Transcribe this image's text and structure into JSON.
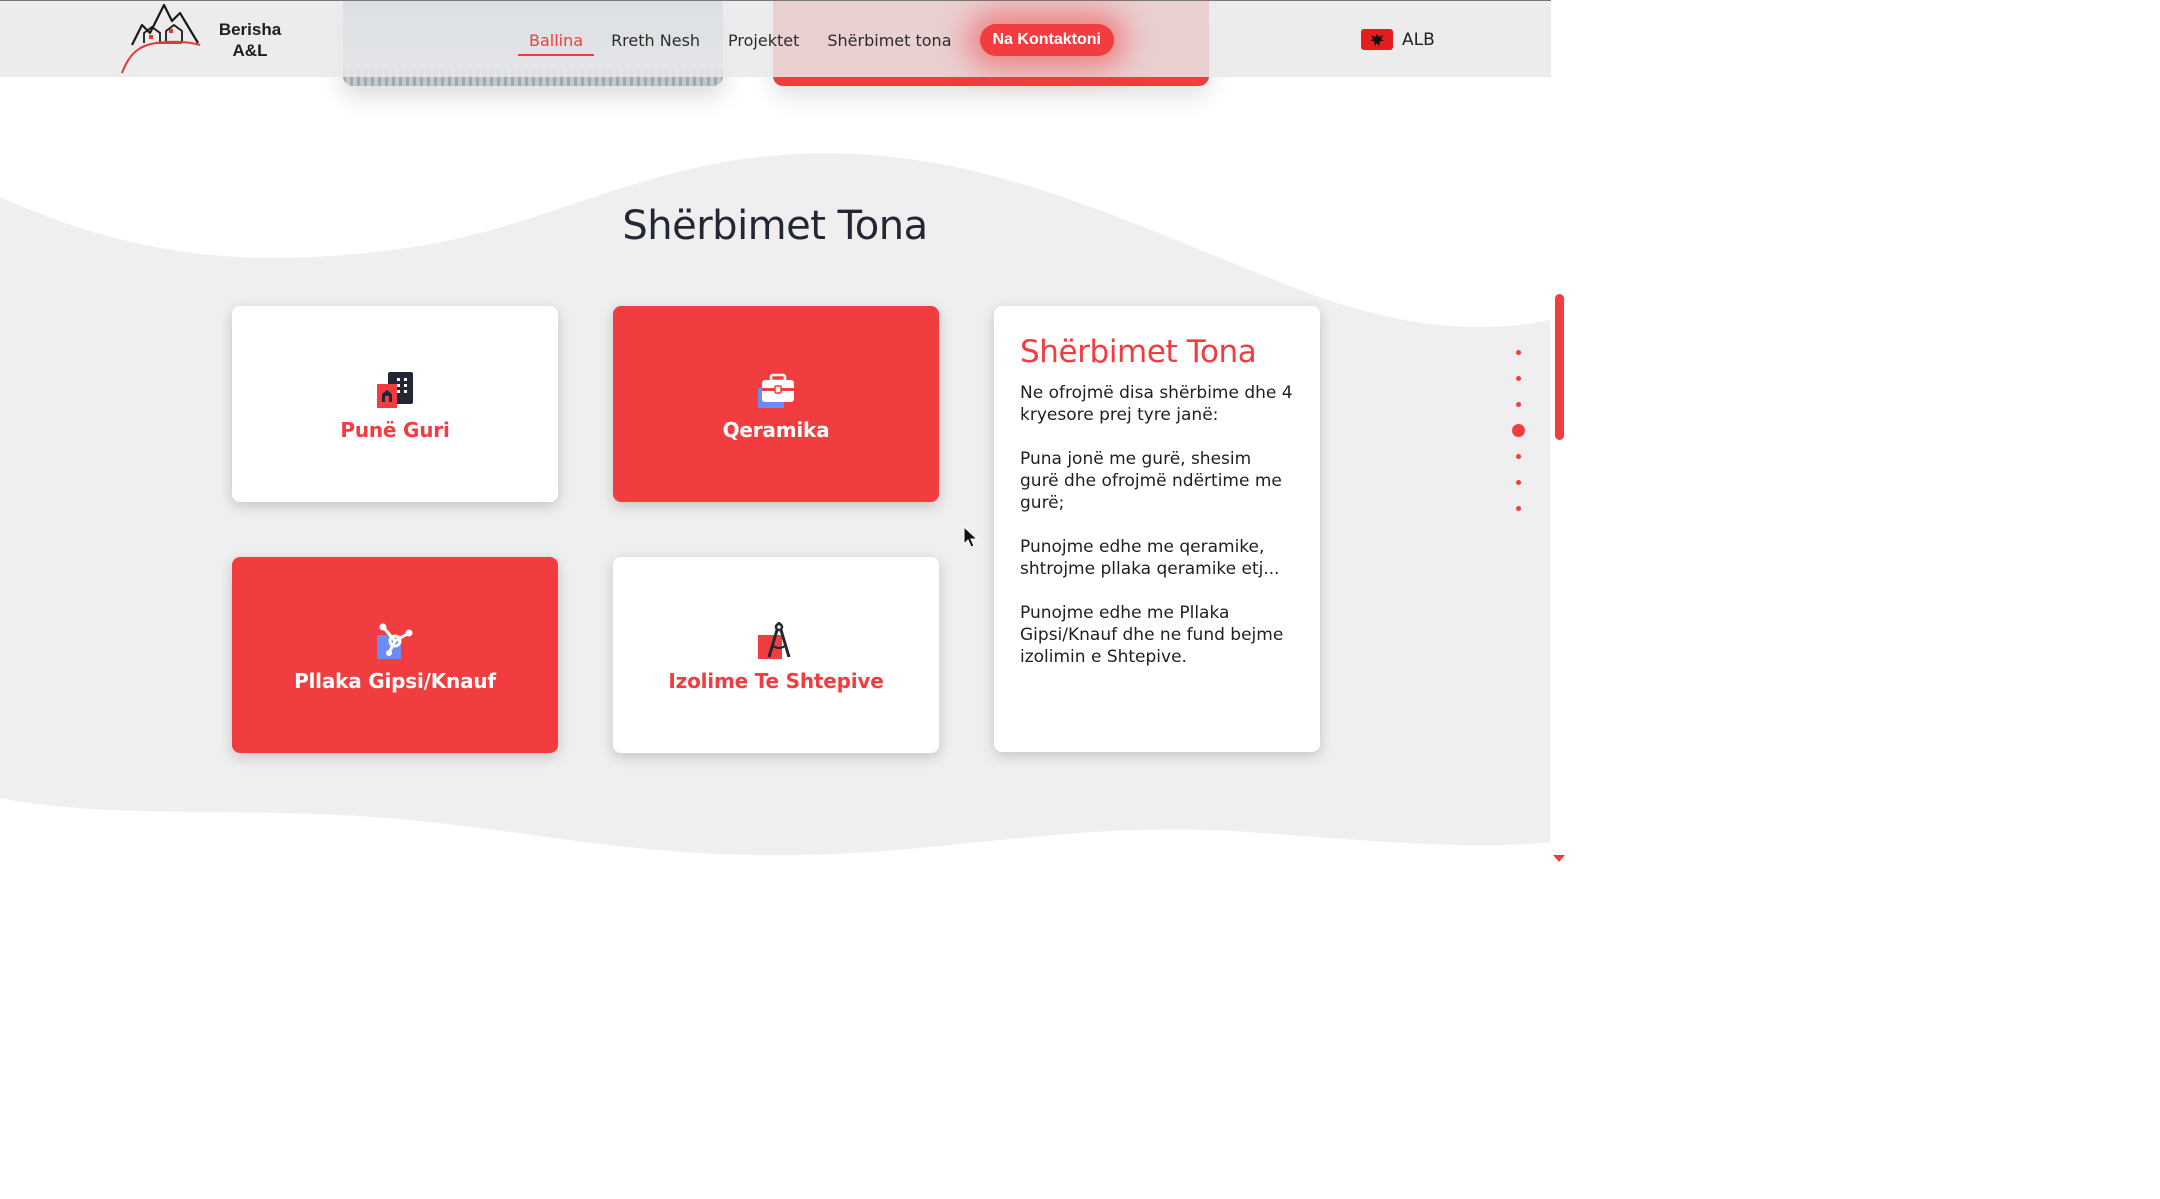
{
  "header": {
    "logo_text_line1": "Berisha",
    "logo_text_line2": "A&L",
    "nav": {
      "home": "Ballina",
      "about": "Rreth Nesh",
      "projects": "Projektet",
      "services": "Shërbimet tona",
      "contact": "Na Kontaktoni"
    },
    "language": {
      "label": "ALB",
      "icon": "albania-flag-icon"
    }
  },
  "section": {
    "title": "Shërbimet Tona",
    "cards": [
      {
        "label": "Punë Guri",
        "icon": "building-icon",
        "style": "white"
      },
      {
        "label": "Qeramika",
        "icon": "toolbox-icon",
        "style": "red"
      },
      {
        "label": "Pllaka Gipsi/Knauf",
        "icon": "nodes-icon",
        "style": "red"
      },
      {
        "label": "Izolime Te Shtepive",
        "icon": "compass-icon",
        "style": "white"
      }
    ],
    "info": {
      "title": "Shërbimet Tona",
      "paragraphs": [
        "Ne ofrojmë disa shërbime dhe 4 kryesore prej tyre janë:",
        "Puna jonë me gurë, shesim gurë dhe ofrojmë ndërtime me gurë;",
        "Punojme edhe me qeramike, shtrojme pllaka qeramike etj...",
        "Punojme edhe me Pllaka Gipsi/Knauf dhe ne fund bejme izolimin e Shtepive."
      ]
    }
  },
  "pager": {
    "count": 7,
    "active_index": 3
  },
  "colors": {
    "accent": "#f13d3f",
    "dark": "#232733",
    "band": "#efefef",
    "icon_blue": "#6b8cf5"
  }
}
